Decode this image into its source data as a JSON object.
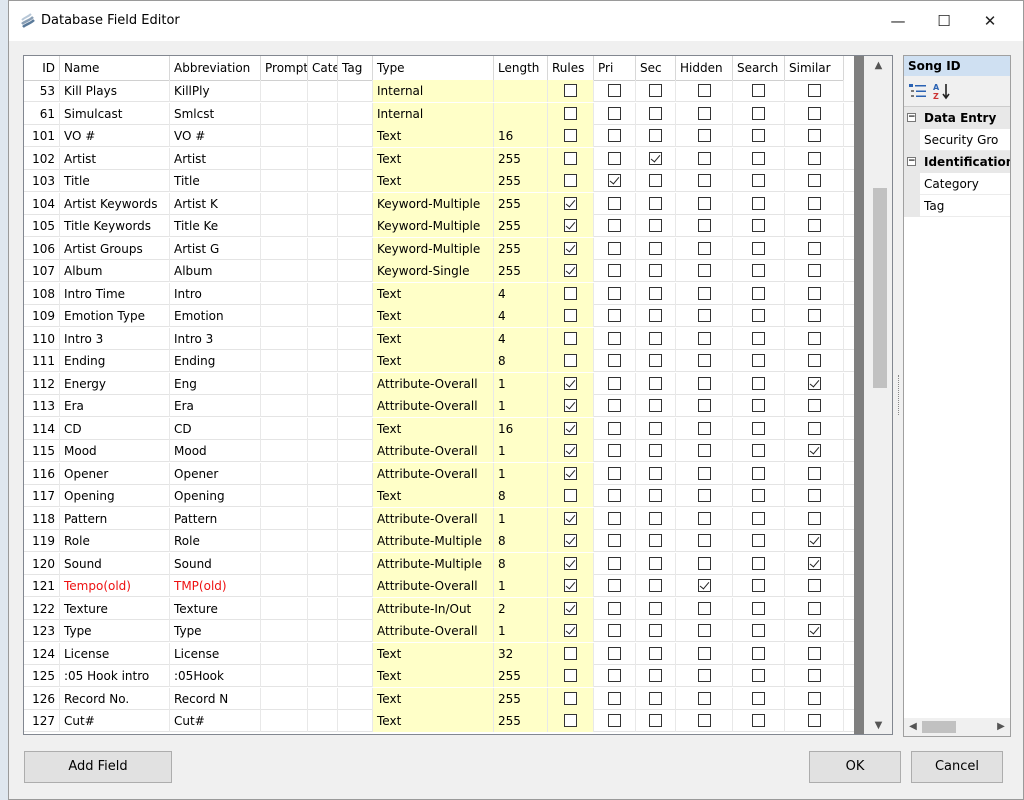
{
  "window": {
    "title": "Database Field Editor",
    "min": "—",
    "max": "☐",
    "close": "✕"
  },
  "columns": [
    "ID",
    "Name",
    "Abbreviation",
    "Prompt",
    "Category",
    "Tag",
    "Type",
    "Length",
    "Rules",
    "Pri",
    "Sec",
    "Hidden",
    "Search",
    "Similar"
  ],
  "rows": [
    {
      "id": "53",
      "name": "Kill Plays",
      "abbr": "KillPly",
      "type": "Internal",
      "length": "",
      "rules": false,
      "pri": false,
      "sec": false,
      "hidden": false,
      "search": false,
      "similar": false
    },
    {
      "id": "61",
      "name": "Simulcast",
      "abbr": "Smlcst",
      "type": "Internal",
      "length": "",
      "rules": false,
      "pri": false,
      "sec": false,
      "hidden": false,
      "search": false,
      "similar": false
    },
    {
      "id": "101",
      "name": "VO #",
      "abbr": "VO #",
      "type": "Text",
      "length": "16",
      "rules": false,
      "pri": false,
      "sec": false,
      "hidden": false,
      "search": false,
      "similar": false
    },
    {
      "id": "102",
      "name": "Artist",
      "abbr": "Artist",
      "type": "Text",
      "length": "255",
      "rules": false,
      "pri": false,
      "sec": true,
      "hidden": false,
      "search": false,
      "similar": false
    },
    {
      "id": "103",
      "name": "Title",
      "abbr": "Title",
      "type": "Text",
      "length": "255",
      "rules": false,
      "pri": true,
      "sec": false,
      "hidden": false,
      "search": false,
      "similar": false
    },
    {
      "id": "104",
      "name": "Artist Keywords",
      "abbr": "Artist K",
      "type": "Keyword-Multiple",
      "length": "255",
      "rules": true,
      "pri": false,
      "sec": false,
      "hidden": false,
      "search": false,
      "similar": false
    },
    {
      "id": "105",
      "name": "Title Keywords",
      "abbr": "Title Ke",
      "type": "Keyword-Multiple",
      "length": "255",
      "rules": true,
      "pri": false,
      "sec": false,
      "hidden": false,
      "search": false,
      "similar": false
    },
    {
      "id": "106",
      "name": "Artist Groups",
      "abbr": "Artist G",
      "type": "Keyword-Multiple",
      "length": "255",
      "rules": true,
      "pri": false,
      "sec": false,
      "hidden": false,
      "search": false,
      "similar": false
    },
    {
      "id": "107",
      "name": "Album",
      "abbr": "Album",
      "type": "Keyword-Single",
      "length": "255",
      "rules": true,
      "pri": false,
      "sec": false,
      "hidden": false,
      "search": false,
      "similar": false
    },
    {
      "id": "108",
      "name": "Intro Time",
      "abbr": "Intro",
      "type": "Text",
      "length": "4",
      "rules": false,
      "pri": false,
      "sec": false,
      "hidden": false,
      "search": false,
      "similar": false
    },
    {
      "id": "109",
      "name": "Emotion Type",
      "abbr": "Emotion",
      "type": "Text",
      "length": "4",
      "rules": false,
      "pri": false,
      "sec": false,
      "hidden": false,
      "search": false,
      "similar": false
    },
    {
      "id": "110",
      "name": "Intro 3",
      "abbr": "Intro 3",
      "type": "Text",
      "length": "4",
      "rules": false,
      "pri": false,
      "sec": false,
      "hidden": false,
      "search": false,
      "similar": false
    },
    {
      "id": "111",
      "name": "Ending",
      "abbr": "Ending",
      "type": "Text",
      "length": "8",
      "rules": false,
      "pri": false,
      "sec": false,
      "hidden": false,
      "search": false,
      "similar": false
    },
    {
      "id": "112",
      "name": "Energy",
      "abbr": "Eng",
      "type": "Attribute-Overall",
      "length": "1",
      "rules": true,
      "pri": false,
      "sec": false,
      "hidden": false,
      "search": false,
      "similar": true
    },
    {
      "id": "113",
      "name": "Era",
      "abbr": "Era",
      "type": "Attribute-Overall",
      "length": "1",
      "rules": true,
      "pri": false,
      "sec": false,
      "hidden": false,
      "search": false,
      "similar": false
    },
    {
      "id": "114",
      "name": "CD",
      "abbr": "CD",
      "type": "Text",
      "length": "16",
      "rules": true,
      "pri": false,
      "sec": false,
      "hidden": false,
      "search": false,
      "similar": false
    },
    {
      "id": "115",
      "name": "Mood",
      "abbr": "Mood",
      "type": "Attribute-Overall",
      "length": "1",
      "rules": true,
      "pri": false,
      "sec": false,
      "hidden": false,
      "search": false,
      "similar": true
    },
    {
      "id": "116",
      "name": "Opener",
      "abbr": "Opener",
      "type": "Attribute-Overall",
      "length": "1",
      "rules": true,
      "pri": false,
      "sec": false,
      "hidden": false,
      "search": false,
      "similar": false
    },
    {
      "id": "117",
      "name": "Opening",
      "abbr": "Opening",
      "type": "Text",
      "length": "8",
      "rules": false,
      "pri": false,
      "sec": false,
      "hidden": false,
      "search": false,
      "similar": false
    },
    {
      "id": "118",
      "name": "Pattern",
      "abbr": "Pattern",
      "type": "Attribute-Overall",
      "length": "1",
      "rules": true,
      "pri": false,
      "sec": false,
      "hidden": false,
      "search": false,
      "similar": false
    },
    {
      "id": "119",
      "name": "Role",
      "abbr": "Role",
      "type": "Attribute-Multiple",
      "length": "8",
      "rules": true,
      "pri": false,
      "sec": false,
      "hidden": false,
      "search": false,
      "similar": true
    },
    {
      "id": "120",
      "name": "Sound",
      "abbr": "Sound",
      "type": "Attribute-Multiple",
      "length": "8",
      "rules": true,
      "pri": false,
      "sec": false,
      "hidden": false,
      "search": false,
      "similar": true
    },
    {
      "id": "121",
      "name": "Tempo(old)",
      "abbr": "TMP(old)",
      "type": "Attribute-Overall",
      "length": "1",
      "rules": true,
      "pri": false,
      "sec": false,
      "hidden": true,
      "search": false,
      "similar": false,
      "red": true
    },
    {
      "id": "122",
      "name": "Texture",
      "abbr": "Texture",
      "type": "Attribute-In/Out",
      "length": "2",
      "rules": true,
      "pri": false,
      "sec": false,
      "hidden": false,
      "search": false,
      "similar": false
    },
    {
      "id": "123",
      "name": "Type",
      "abbr": "Type",
      "type": "Attribute-Overall",
      "length": "1",
      "rules": true,
      "pri": false,
      "sec": false,
      "hidden": false,
      "search": false,
      "similar": true
    },
    {
      "id": "124",
      "name": "License",
      "abbr": "License",
      "type": "Text",
      "length": "32",
      "rules": false,
      "pri": false,
      "sec": false,
      "hidden": false,
      "search": false,
      "similar": false
    },
    {
      "id": "125",
      "name": ":05 Hook intro",
      "abbr": ":05Hook",
      "type": "Text",
      "length": "255",
      "rules": false,
      "pri": false,
      "sec": false,
      "hidden": false,
      "search": false,
      "similar": false
    },
    {
      "id": "126",
      "name": "Record No.",
      "abbr": "Record N",
      "type": "Text",
      "length": "255",
      "rules": false,
      "pri": false,
      "sec": false,
      "hidden": false,
      "search": false,
      "similar": false
    },
    {
      "id": "127",
      "name": "Cut#",
      "abbr": "Cut#",
      "type": "Text",
      "length": "255",
      "rules": false,
      "pri": false,
      "sec": false,
      "hidden": false,
      "search": false,
      "similar": false
    }
  ],
  "properties": {
    "title": "Song ID",
    "categories": [
      {
        "label": "Data Entry",
        "items": [
          "Security Gro"
        ]
      },
      {
        "label": "Identification",
        "items": [
          "Category",
          "Tag"
        ]
      }
    ]
  },
  "buttons": {
    "add": "Add Field",
    "ok": "OK",
    "cancel": "Cancel"
  },
  "colors": {
    "yellow_cell": "#ffffc8",
    "red_text": "#e11111",
    "prop_title_bg": "#cfe0f2"
  }
}
